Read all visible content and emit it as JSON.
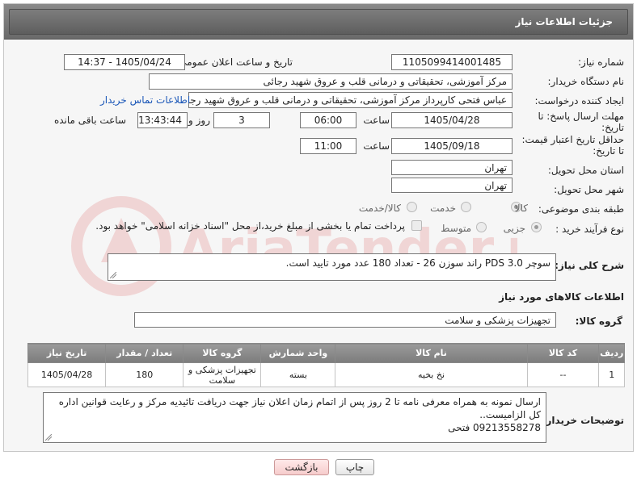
{
  "header": {
    "title": "جزئیات اطلاعات نیاز"
  },
  "form": {
    "need_number_label": "شماره نیاز:",
    "need_number": "1105099414001485",
    "announce_label": "تاریخ و ساعت اعلان عمومی:",
    "announce_value": "1405/04/24 - 14:37",
    "buyer_org_label": "نام دستگاه خریدار:",
    "buyer_org": "مرکز آموزشی، تحقیقاتی و درمانی قلب و عروق شهید رجائی",
    "creator_label": "ایجاد کننده درخواست:",
    "creator": "عباس فتحی کارپرداز مرکز آموزشی، تحقیقاتی و درمانی قلب و عروق شهید رجائی",
    "contact_link": "اطلاعات تماس خریدار",
    "reply_deadline_label": "مهلت ارسال پاسخ: تا تاریخ:",
    "reply_date": "1405/04/28",
    "time_label": "ساعت",
    "reply_time": "06:00",
    "days_value": "3",
    "days_label": "روز و",
    "remaining_time": "13:43:44",
    "remaining_label": "ساعت باقی مانده",
    "price_validity_label": "حداقل تاریخ اعتبار قیمت: تا تاریخ:",
    "validity_date": "1405/09/18",
    "validity_time_label": "ساعت",
    "validity_time": "11:00",
    "province_label": "استان محل تحویل:",
    "province": "تهران",
    "city_label": "شهر محل تحویل:",
    "city": "تهران",
    "category_label": "طبقه بندی موضوعی:",
    "category_options": [
      "کالا",
      "خدمت",
      "کالا/خدمت"
    ],
    "purchase_type_label": "نوع فرآیند خرید :",
    "purchase_options": [
      "جزیی",
      "متوسط"
    ],
    "payment_note": "پرداخت تمام یا بخشی از مبلغ خرید،از محل \"اسناد خزانه اسلامی\" خواهد بود.",
    "overall_desc_label": "شرح کلی نیاز:",
    "overall_desc": "سوچر PDS 3.0 راند سوزن 26  -   تعداد 180 عدد مورد تایید است."
  },
  "goods": {
    "section_title": "اطلاعات کالاهای مورد نیاز",
    "group_label": "گروه کالا:",
    "group_value": "تجهیزات پزشکی و سلامت",
    "columns": [
      "ردیف",
      "کد کالا",
      "نام کالا",
      "واحد شمارش",
      "گروه کالا",
      "تعداد / مقدار",
      "تاریخ نیاز"
    ],
    "rows": [
      {
        "row": "1",
        "code": "--",
        "name": "نخ بخیه",
        "unit": "بسته",
        "group": "تجهیزات پزشکی و سلامت",
        "qty": "180",
        "date": "1405/04/28"
      }
    ]
  },
  "buyer_notes": {
    "label": "توضیحات خریدار:",
    "line1": "ارسال نمونه به همراه معرفی نامه تا 2 روز پس از اتمام زمان اعلان نیاز جهت دریافت تائیدیه مرکز و رعایت قوانین اداره کل الزامیست..",
    "line2": "09213558278 فتحی"
  },
  "actions": {
    "print_label": "چاپ",
    "back_label": "بازگشت"
  },
  "watermark_text": "AriaTender.neT",
  "colors": {
    "header_bg": "#6e6e6e",
    "link": "#1b57b8",
    "back_button": "#f6cccc"
  }
}
